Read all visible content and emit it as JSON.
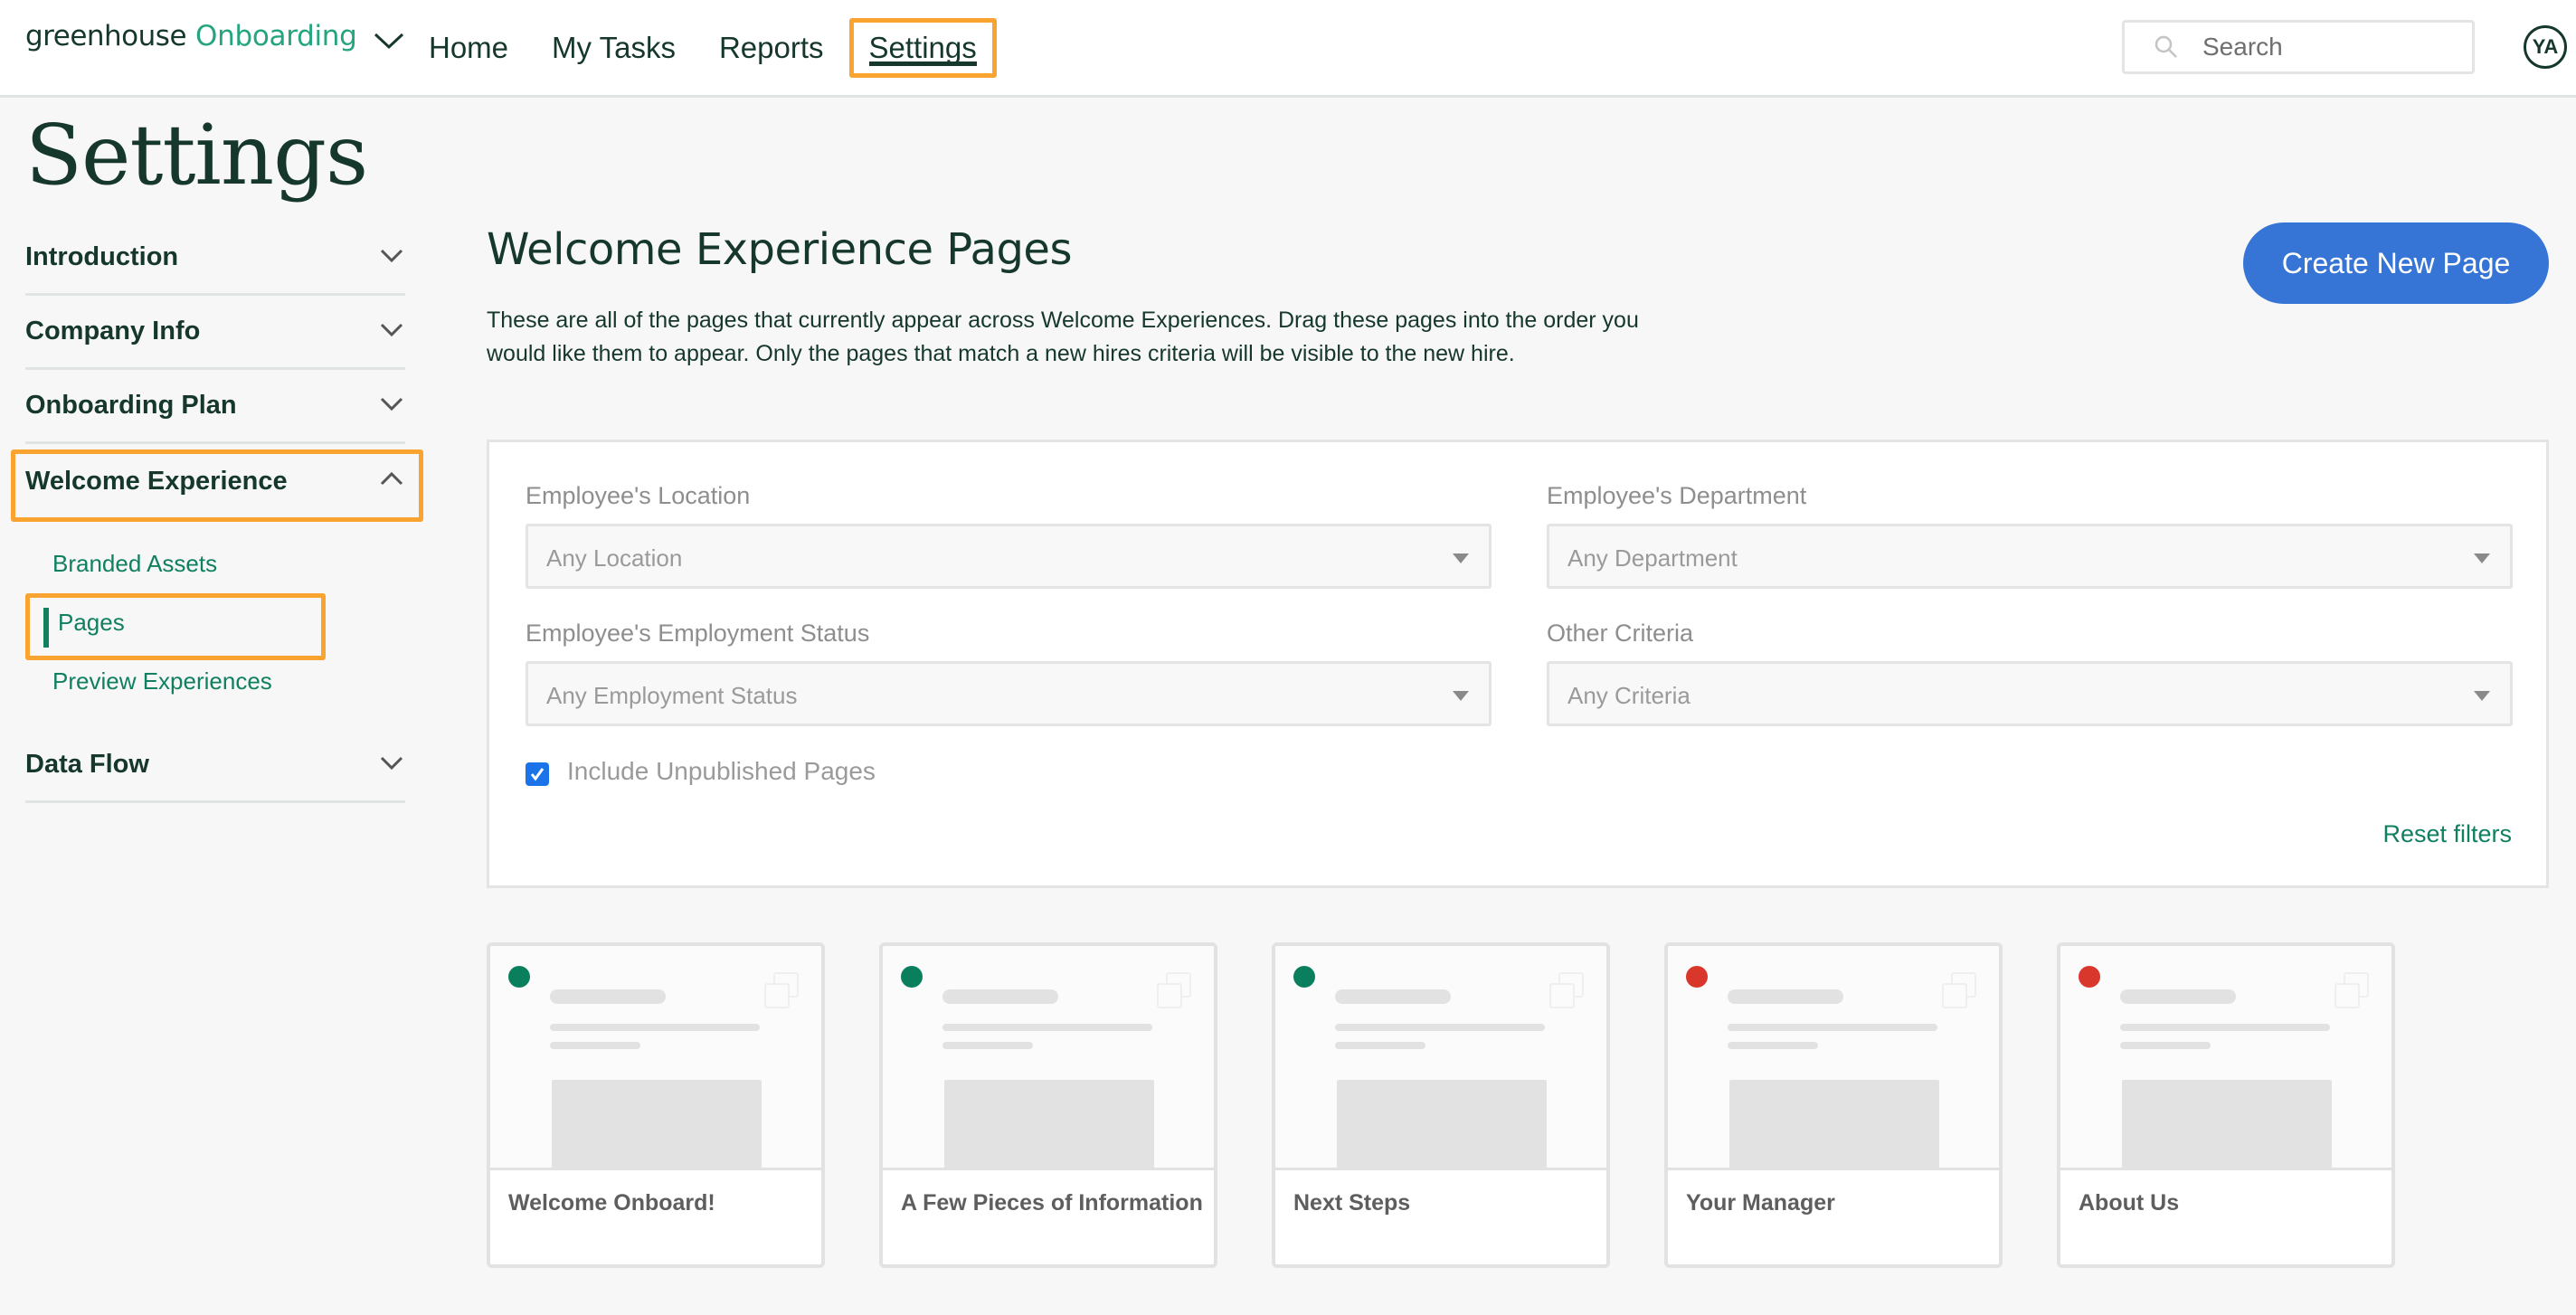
{
  "app": {
    "brand_primary": "greenhouse",
    "brand_secondary": "Onboarding",
    "brand_menu_icon": "chevron-down-icon"
  },
  "nav": {
    "items": [
      {
        "label": "Home",
        "active": false
      },
      {
        "label": "My Tasks",
        "active": false
      },
      {
        "label": "Reports",
        "active": false
      },
      {
        "label": "Settings",
        "active": true
      }
    ]
  },
  "search": {
    "placeholder": "Search",
    "icon": "search-icon"
  },
  "user": {
    "initials": "YA"
  },
  "page": {
    "title": "Settings"
  },
  "sidebar": {
    "sections": [
      {
        "label": "Introduction",
        "expanded": false,
        "icon": "chevron-down-icon"
      },
      {
        "label": "Company Info",
        "expanded": false,
        "icon": "chevron-down-icon"
      },
      {
        "label": "Onboarding Plan",
        "expanded": false,
        "icon": "chevron-down-icon"
      },
      {
        "label": "Welcome Experience",
        "expanded": true,
        "icon": "chevron-up-icon",
        "items": [
          {
            "label": "Branded Assets",
            "active": false
          },
          {
            "label": "Pages",
            "active": true
          },
          {
            "label": "Preview Experiences",
            "active": false
          }
        ]
      },
      {
        "label": "Data Flow",
        "expanded": false,
        "icon": "chevron-down-icon"
      }
    ]
  },
  "main": {
    "title": "Welcome Experience Pages",
    "description": "These are all of the pages that currently appear across Welcome Experiences. Drag these pages into the order you would like them to appear. Only the pages that match a new hires criteria will be visible to the new hire.",
    "create_button": "Create New Page",
    "filters": {
      "location": {
        "label": "Employee's Location",
        "value": "Any Location"
      },
      "department": {
        "label": "Employee's Department",
        "value": "Any Department"
      },
      "employment_status": {
        "label": "Employee's Employment Status",
        "value": "Any Employment Status"
      },
      "other": {
        "label": "Other Criteria",
        "value": "Any Criteria"
      },
      "include_unpublished": {
        "label": "Include Unpublished Pages",
        "checked": true
      },
      "reset_label": "Reset filters"
    },
    "pages": [
      {
        "name": "Welcome Onboard!",
        "status": "published",
        "status_color": "#0a7f5d"
      },
      {
        "name": "A Few Pieces of Information",
        "status": "published",
        "status_color": "#0a7f5d"
      },
      {
        "name": "Next Steps",
        "status": "published",
        "status_color": "#0a7f5d"
      },
      {
        "name": "Your Manager",
        "status": "unpublished",
        "status_color": "#d9372b"
      },
      {
        "name": "About Us",
        "status": "unpublished",
        "status_color": "#d9372b"
      }
    ]
  },
  "colors": {
    "brand_dark": "#15372c",
    "brand_green": "#24a47f",
    "link_green": "#108060",
    "primary_button": "#3675d6",
    "highlight": "#f9a430",
    "checkbox": "#1a73e8"
  }
}
